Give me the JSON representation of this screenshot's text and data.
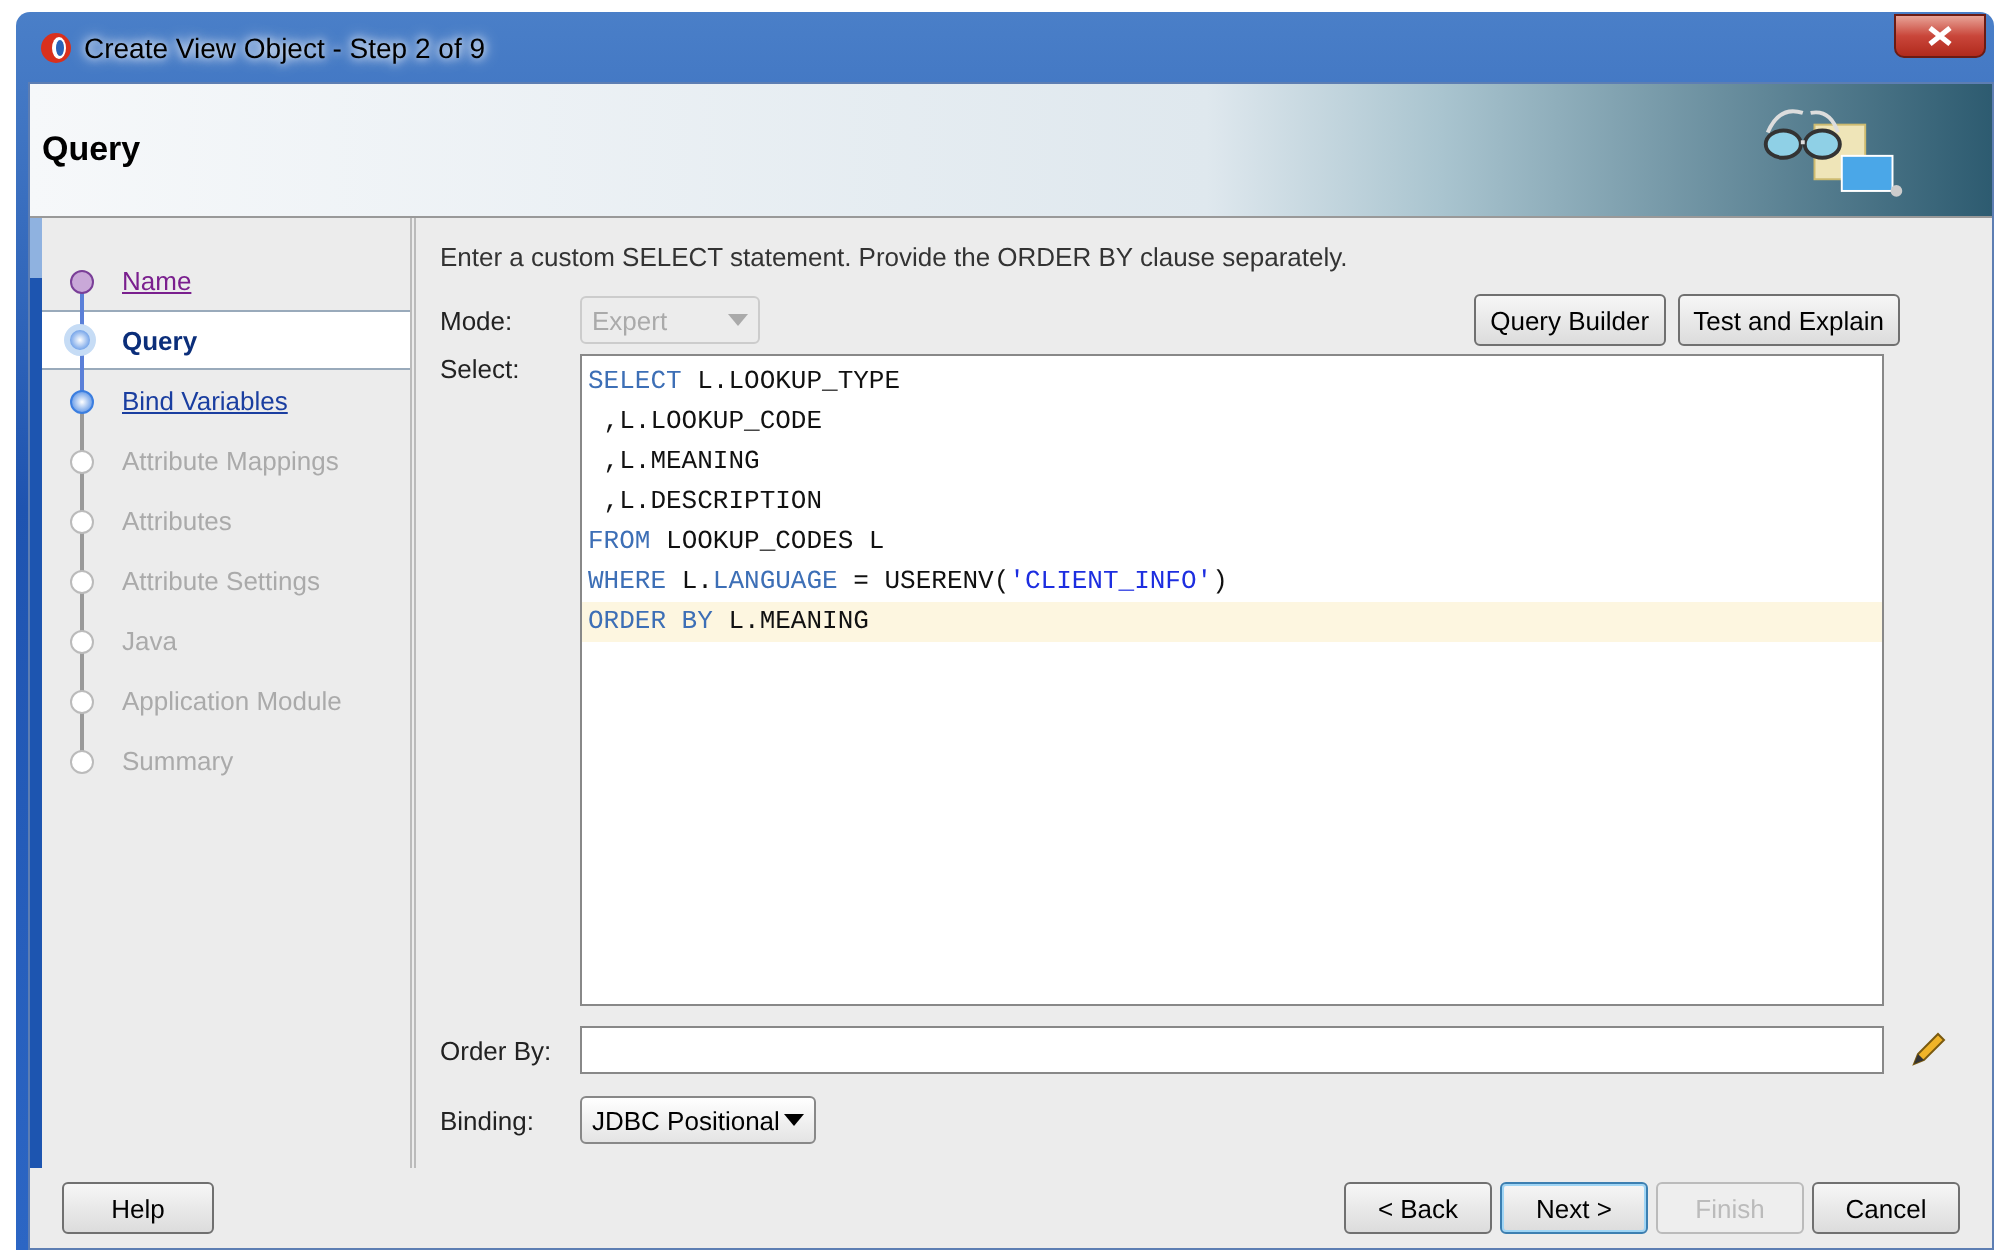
{
  "window": {
    "title": "Create View Object - Step 2 of 9"
  },
  "header": {
    "title": "Query"
  },
  "steps": [
    {
      "label": "Name",
      "kind": "visited",
      "selected": false
    },
    {
      "label": "Query",
      "kind": "current",
      "selected": true
    },
    {
      "label": "Bind Variables",
      "kind": "available",
      "selected": false
    },
    {
      "label": "Attribute Mappings",
      "kind": "disabled",
      "selected": false
    },
    {
      "label": "Attributes",
      "kind": "disabled",
      "selected": false
    },
    {
      "label": "Attribute Settings",
      "kind": "disabled",
      "selected": false
    },
    {
      "label": "Java",
      "kind": "disabled",
      "selected": false
    },
    {
      "label": "Application Module",
      "kind": "disabled",
      "selected": false
    },
    {
      "label": "Summary",
      "kind": "disabled",
      "selected": false
    }
  ],
  "instructions": "Enter a custom SELECT statement. Provide the ORDER BY clause separately.",
  "mode": {
    "label": "Mode:",
    "value": "Expert",
    "disabled": true
  },
  "query_buttons": [
    "Query Builder",
    "Test and Explain"
  ],
  "select": {
    "label": "Select:",
    "lines": [
      {
        "highlighted": false,
        "tokens": [
          {
            "kind": "keyword",
            "text": "SELECT"
          },
          {
            "kind": "plain",
            "text": " L.LOOKUP_TYPE"
          }
        ]
      },
      {
        "highlighted": false,
        "tokens": [
          {
            "kind": "plain",
            "text": " ,L.LOOKUP_CODE"
          }
        ]
      },
      {
        "highlighted": false,
        "tokens": [
          {
            "kind": "plain",
            "text": " ,L.MEANING"
          }
        ]
      },
      {
        "highlighted": false,
        "tokens": [
          {
            "kind": "plain",
            "text": " ,L.DESCRIPTION"
          }
        ]
      },
      {
        "highlighted": false,
        "tokens": [
          {
            "kind": "keyword",
            "text": "FROM"
          },
          {
            "kind": "plain",
            "text": " LOOKUP_CODES L"
          }
        ]
      },
      {
        "highlighted": false,
        "tokens": [
          {
            "kind": "keyword",
            "text": "WHERE"
          },
          {
            "kind": "plain",
            "text": " L."
          },
          {
            "kind": "keyword",
            "text": "LANGUAGE"
          },
          {
            "kind": "plain",
            "text": " = USERENV("
          },
          {
            "kind": "string",
            "text": "'CLIENT_INFO'"
          },
          {
            "kind": "plain",
            "text": ")"
          }
        ]
      },
      {
        "highlighted": true,
        "tokens": [
          {
            "kind": "keyword",
            "text": "ORDER BY"
          },
          {
            "kind": "plain",
            "text": " L.MEANING"
          }
        ]
      }
    ]
  },
  "order_by": {
    "label": "Order By:"
  },
  "binding": {
    "label": "Binding:",
    "value": "JDBC Positional"
  },
  "footer": {
    "help": "Help",
    "buttons": [
      {
        "label": "< Back",
        "disabled": false,
        "default": false
      },
      {
        "label": "Next >",
        "disabled": false,
        "default": true
      },
      {
        "label": "Finish",
        "disabled": true,
        "default": false
      },
      {
        "label": "Cancel",
        "disabled": false,
        "default": false
      }
    ]
  }
}
